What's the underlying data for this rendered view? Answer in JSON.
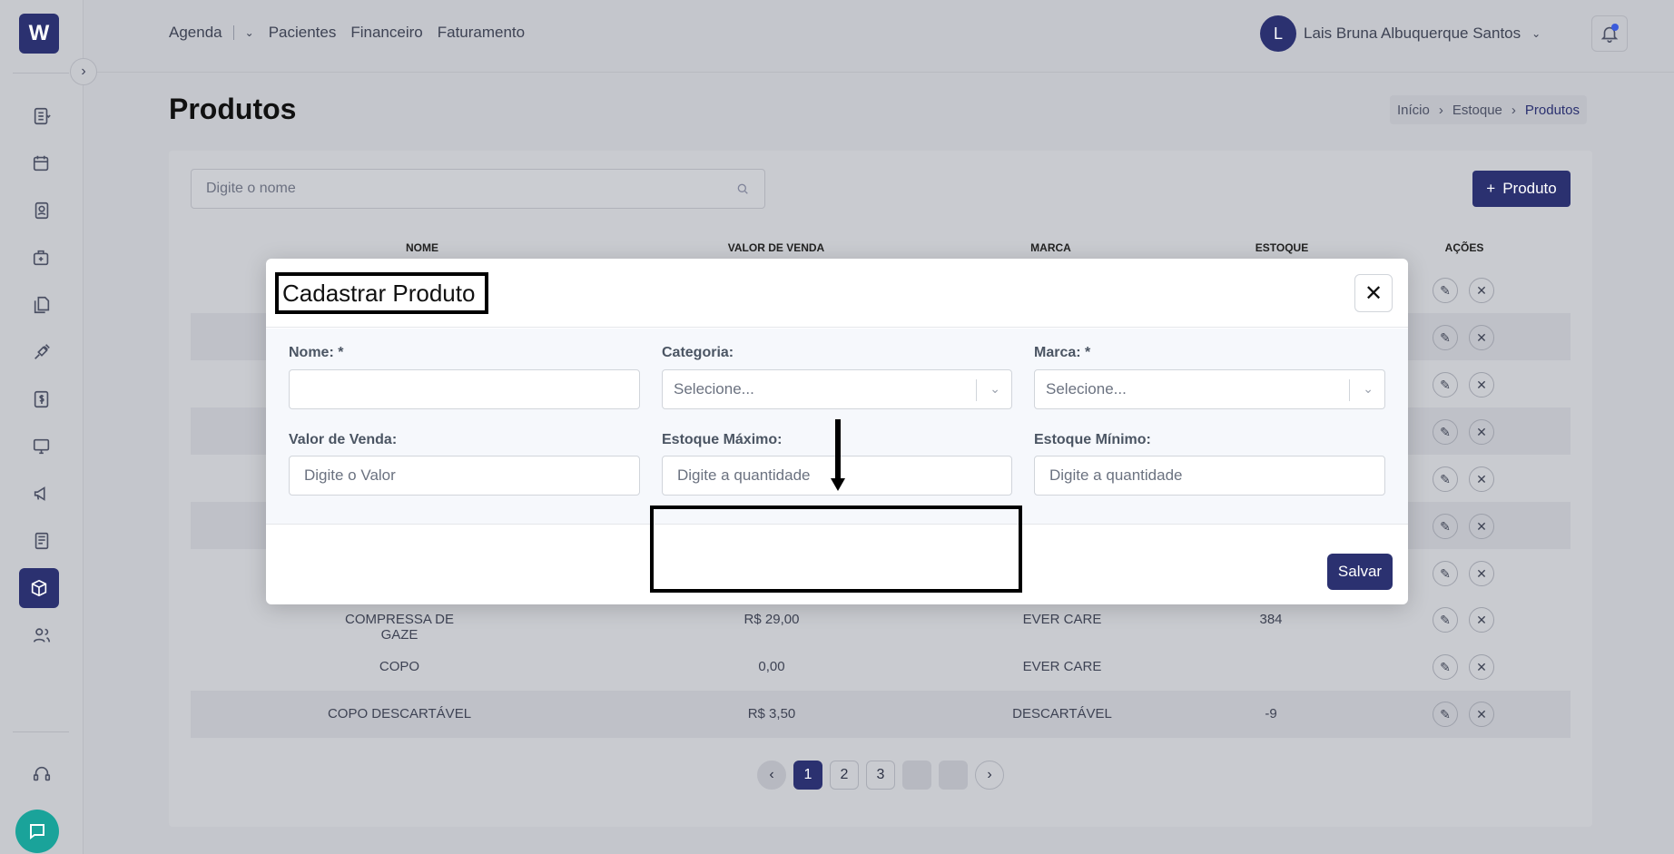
{
  "app": {
    "logo_text": "W"
  },
  "topnav": {
    "items": [
      "Agenda",
      "Pacientes",
      "Financeiro",
      "Faturamento"
    ]
  },
  "user": {
    "initial": "L",
    "name": "Lais Bruna Albuquerque Santos"
  },
  "page": {
    "title": "Produtos"
  },
  "breadcrumb": {
    "items": [
      "Início",
      "Estoque",
      "Produtos"
    ]
  },
  "search": {
    "placeholder": "Digite o nome"
  },
  "add_button": {
    "label": "Produto"
  },
  "table": {
    "headers": [
      "NOME",
      "VALOR DE VENDA",
      "MARCA",
      "ESTOQUE",
      "AÇÕES"
    ],
    "rows": [
      {
        "nome": "COMPRESSA DE GAZE",
        "valor": "R$ 29,00",
        "marca": "EVER CARE",
        "estoque": "384"
      },
      {
        "nome": "COPO",
        "valor": "0,00",
        "marca": "EVER CARE",
        "estoque": ""
      },
      {
        "nome": "COPO DESCARTÁVEL",
        "valor": "R$ 3,50",
        "marca": "DESCARTÁVEL",
        "estoque": "-9"
      }
    ]
  },
  "pagination": {
    "pages": [
      "1",
      "2",
      "3"
    ],
    "active": "1"
  },
  "modal": {
    "title": "Cadastrar Produto",
    "fields": {
      "nome": {
        "label": "Nome: *",
        "value": ""
      },
      "categoria": {
        "label": "Categoria:",
        "placeholder": "Selecione..."
      },
      "marca": {
        "label": "Marca: *",
        "placeholder": "Selecione..."
      },
      "valor_venda": {
        "label": "Valor de Venda:",
        "placeholder": "Digite o Valor"
      },
      "estoque_maximo": {
        "label": "Estoque Máximo:",
        "placeholder": "Digite a quantidade"
      },
      "estoque_minimo": {
        "label": "Estoque Mínimo:",
        "placeholder": "Digite a quantidade"
      }
    },
    "save_label": "Salvar"
  },
  "colors": {
    "primary": "#2b3170",
    "chat": "#1aa39a",
    "overlay": "#c4c6cc"
  }
}
